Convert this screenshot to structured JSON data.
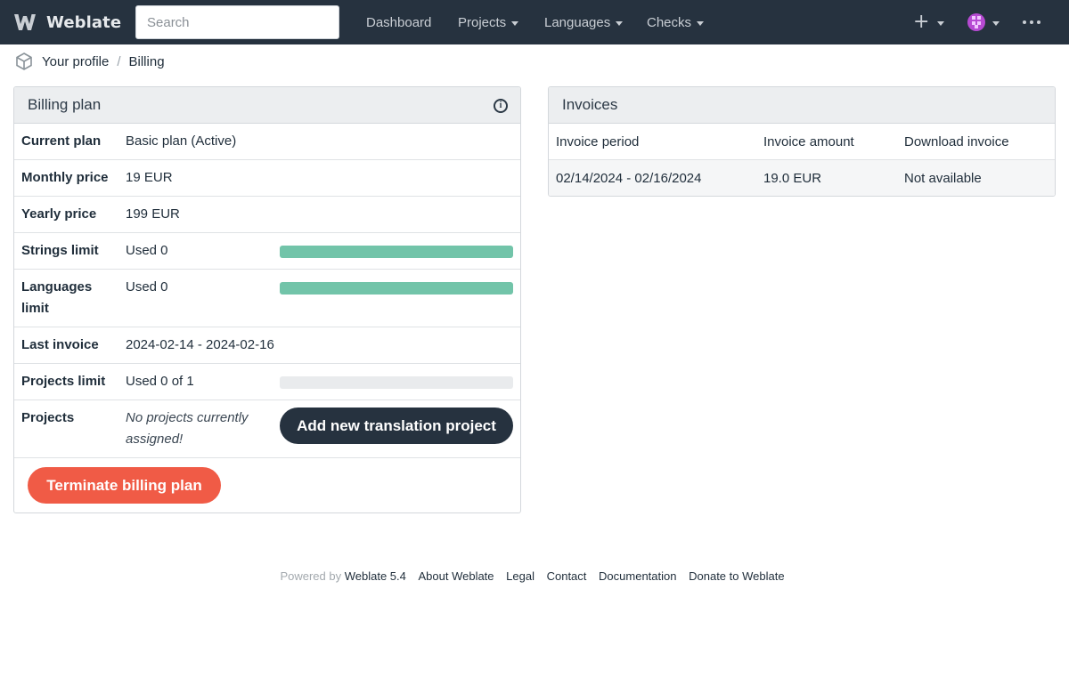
{
  "navbar": {
    "brand": "Weblate",
    "search_placeholder": "Search",
    "links": {
      "dashboard": "Dashboard",
      "projects": "Projects",
      "languages": "Languages",
      "checks": "Checks"
    },
    "plus": "+"
  },
  "breadcrumb": {
    "profile": "Your profile",
    "separator": "/",
    "current": "Billing"
  },
  "billing": {
    "title": "Billing plan",
    "rows": {
      "current_plan": {
        "label": "Current plan",
        "value": "Basic plan (Active)"
      },
      "monthly_price": {
        "label": "Monthly price",
        "value": "19 EUR"
      },
      "yearly_price": {
        "label": "Yearly price",
        "value": "199 EUR"
      },
      "strings_limit": {
        "label": "Strings limit",
        "value": "Used 0",
        "progress": 1.0
      },
      "languages_limit": {
        "label": "Languages limit",
        "value": "Used 0",
        "progress": 1.0
      },
      "last_invoice": {
        "label": "Last invoice",
        "value": "2024-02-14 - 2024-02-16"
      },
      "projects_limit": {
        "label": "Projects limit",
        "value": "Used 0 of 1",
        "progress": 0.0
      },
      "projects": {
        "label": "Projects",
        "value": "No projects currently assigned!"
      }
    },
    "add_project_button": "Add new translation project",
    "terminate_button": "Terminate billing plan"
  },
  "invoices": {
    "title": "Invoices",
    "columns": [
      "Invoice period",
      "Invoice amount",
      "Download invoice"
    ],
    "rows": [
      [
        "02/14/2024 - 02/16/2024",
        "19.0 EUR",
        "Not available"
      ]
    ]
  },
  "footer": {
    "powered_by": "Powered by",
    "links": [
      "Weblate 5.4",
      "About Weblate",
      "Legal",
      "Contact",
      "Documentation",
      "Donate to Weblate"
    ]
  },
  "colors": {
    "navbar": "#26323f",
    "progress": "#72c4a9",
    "danger": "#f05b46",
    "primary_button": "#26323f"
  },
  "icons": {
    "brand": "weblate-logo-icon",
    "breadcrumb": "cube-icon",
    "info": "info-circle-icon",
    "menu": "more-dots-icon",
    "caret": "caret-down-icon",
    "user": "avatar-icon"
  }
}
